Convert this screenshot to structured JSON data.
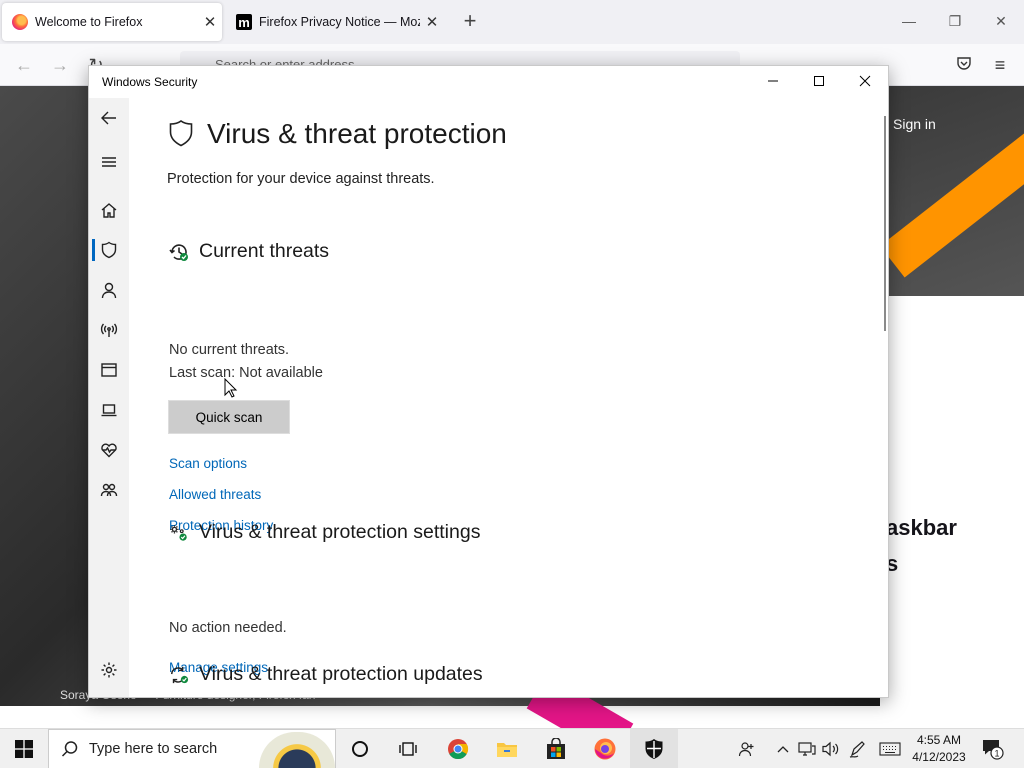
{
  "firefox": {
    "tabs": [
      {
        "title": "Welcome to Firefox",
        "active": true
      },
      {
        "title": "Firefox Privacy Notice — Mozill",
        "active": false
      }
    ],
    "new_tab_glyph": "+",
    "address_placeholder": "Search or enter address",
    "page": {
      "sign_in": "Sign in",
      "headline_fragment_1": "askbar",
      "headline_fragment_2": "s",
      "photo_credit": "Soraya Osorio — Furniture designer, Firefox fan"
    }
  },
  "security": {
    "window_title": "Windows Security",
    "header": {
      "title": "Virus & threat protection",
      "subtitle": "Protection for your device against threats."
    },
    "current_threats": {
      "title": "Current threats",
      "status": "No current threats.",
      "last_scan": "Last scan: Not available",
      "quick_scan_label": "Quick scan",
      "links": [
        "Scan options",
        "Allowed threats",
        "Protection history"
      ]
    },
    "settings": {
      "title": "Virus & threat protection settings",
      "status": "No action needed.",
      "link": "Manage settings"
    },
    "updates": {
      "title": "Virus & threat protection updates"
    },
    "sidebar_items": [
      "back-icon",
      "menu-icon",
      "home-icon",
      "shield-icon",
      "account-icon",
      "network-icon",
      "app-browser-icon",
      "device-security-icon",
      "health-icon",
      "family-icon",
      "settings-icon"
    ],
    "accent_color": "#0067c0",
    "link_color": "#0067b8",
    "ok_color": "#10893e"
  },
  "taskbar": {
    "search_placeholder": "Type here to search",
    "apps": [
      "cortana-icon",
      "task-view-icon",
      "chrome-icon",
      "file-explorer-icon",
      "store-icon",
      "firefox-icon",
      "windows-security-icon"
    ],
    "clock": {
      "time": "4:55 AM",
      "date": "4/12/2023"
    },
    "notification_count": "1"
  }
}
